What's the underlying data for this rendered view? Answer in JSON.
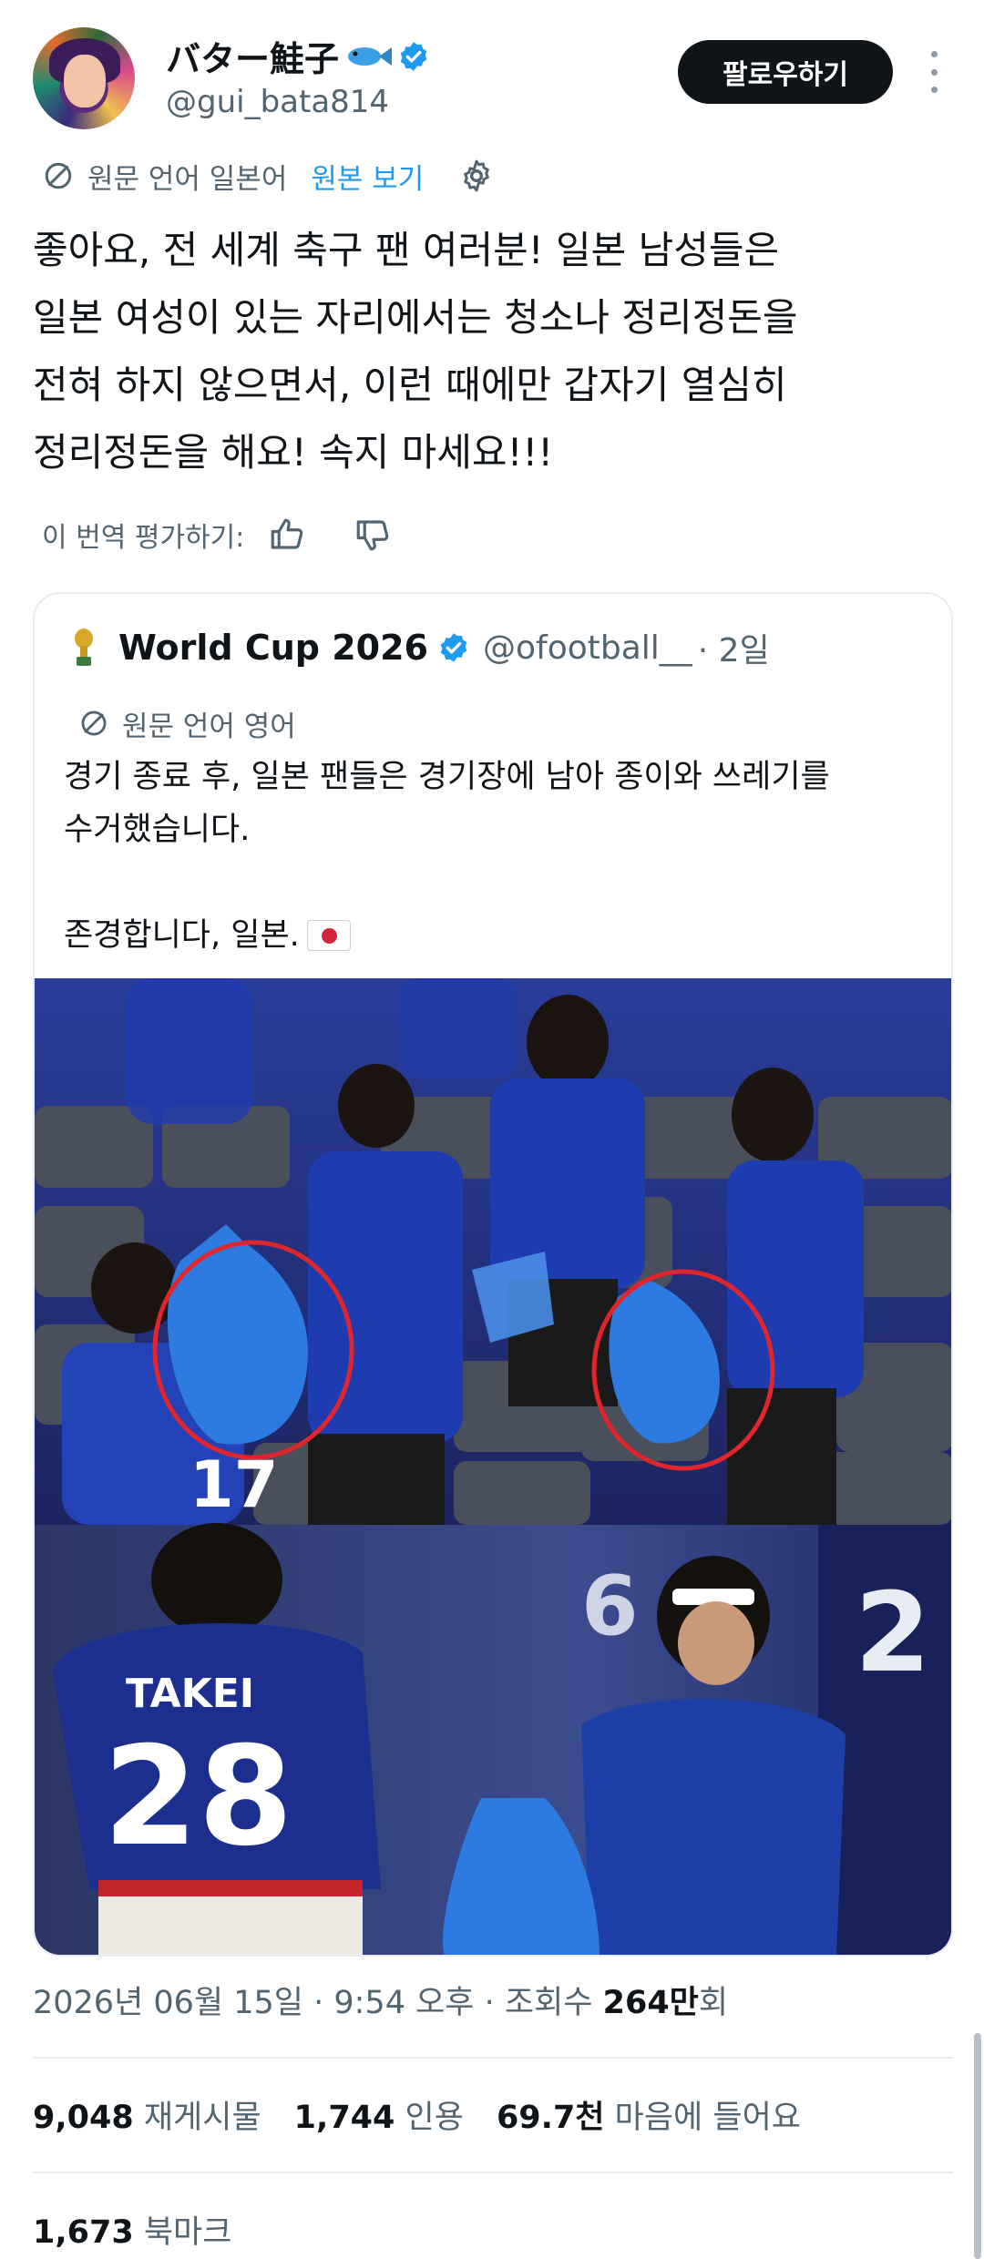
{
  "author": {
    "display_name": "バター鮭子",
    "handle": "@gui_bata814"
  },
  "follow_label": "팔로우하기",
  "translation": {
    "source_label": "원문 언어 일본어",
    "show_original": "원본 보기"
  },
  "tweet_text": "좋아요, 전 세계 축구 팬 여러분! 일본 남성들은\n일본 여성이 있는 자리에서는 청소나 정리정돈을\n전혀 하지 않으면서, 이런 때에만 갑자기 열심히\n정리정돈을 해요! 속지 마세요!!!",
  "rate_label": "이 번역 평가하기:",
  "quoted": {
    "name": "World Cup 2026",
    "handle": "@ofootball__",
    "time": "· 2일",
    "source_label": "원문 언어 영어",
    "text": "경기 종료 후, 일본 팬들은 경기장에 남아 종이와 쓰레기를\n수거했습니다.\n\n존경합니다, 일본.",
    "image_text": {
      "jersey_name": "TAKEI",
      "jersey_number": "28",
      "jersey_number_small": "17",
      "jersey_number_back": "2",
      "jersey_number_back2": "6"
    }
  },
  "meta": {
    "timestamp": "2026년 06월 15일 · 9:54 오후 · 조회수 ",
    "views": "264만",
    "views_suffix": "회"
  },
  "stats": {
    "retweets": "9,048",
    "retweets_label": "재게시물",
    "quotes": "1,744",
    "quotes_label": "인용",
    "likes": "69.7천",
    "likes_label": "마음에 들어요",
    "bookmarks": "1,673",
    "bookmarks_label": "북마크"
  },
  "colors": {
    "accent": "#1d9bf0",
    "text": "#0f1419",
    "secondary": "#536471",
    "annotation_circle": "#e0262c",
    "jersey_blue": "#1c2f8f"
  }
}
